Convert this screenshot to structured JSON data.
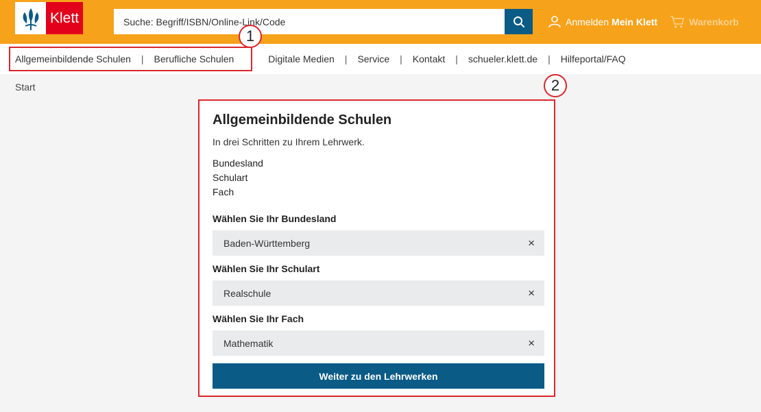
{
  "header": {
    "logo_text": "Klett",
    "search_placeholder": "Suche: Begriff/ISBN/Online-Link/Code",
    "login_label": "Anmelden",
    "mein_klett_label": "Mein Klett",
    "cart_label": "Warenkorb"
  },
  "nav": {
    "items": [
      "Allgemeinbildende Schulen",
      "Berufliche Schulen",
      "Digitale Medien",
      "Service",
      "Kontakt",
      "schueler.klett.de",
      "Hilfeportal/FAQ"
    ],
    "separator": "|"
  },
  "breadcrumb": "Start",
  "annotations": [
    "1",
    "2"
  ],
  "card": {
    "title": "Allgemeinbildende Schulen",
    "intro": "In drei Schritten zu Ihrem Lehrwerk.",
    "steps": [
      "Bundesland",
      "Schulart",
      "Fach"
    ],
    "fields": [
      {
        "label": "Wählen Sie Ihr Bundesland",
        "value": "Baden-Württemberg"
      },
      {
        "label": "Wählen Sie Ihr Schulart",
        "value": "Realschule"
      },
      {
        "label": "Wählen Sie Ihr Fach",
        "value": "Mathematik"
      }
    ],
    "clear_symbol": "×",
    "submit_label": "Weiter zu den Lehrwerken"
  },
  "colors": {
    "header_orange": "#f7a21b",
    "brand_red": "#e3001b",
    "primary_blue": "#0a5b86",
    "annotation_red": "#d9262c"
  }
}
